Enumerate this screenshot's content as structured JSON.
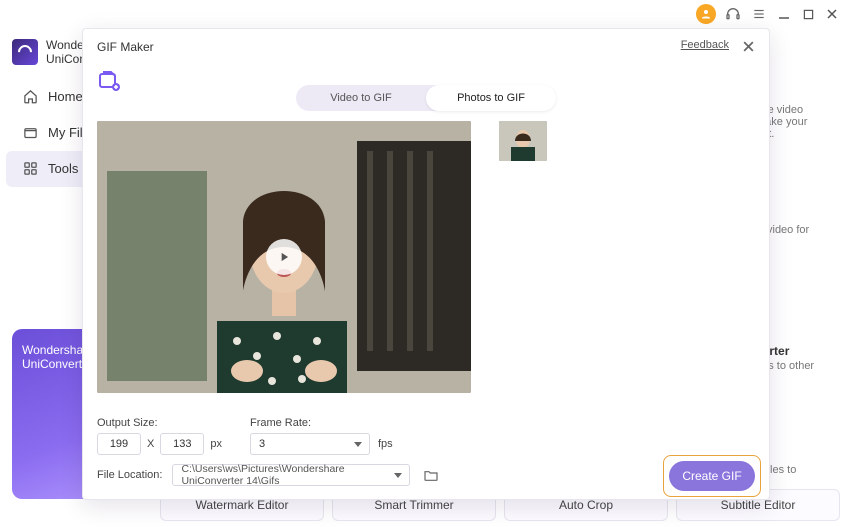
{
  "app": {
    "brand_line1": "Wondershare",
    "brand_line2": "UniConverter"
  },
  "sidebar": {
    "items": [
      {
        "label": "Home"
      },
      {
        "label": "My Files"
      },
      {
        "label": "Tools"
      }
    ]
  },
  "promo": {
    "line1": "Wondershare",
    "line2": "UniConverter"
  },
  "bg_cards": {
    "c1_text": "use video make your out.",
    "c2_text": "D video for",
    "c3_title": "verter",
    "c3_text": "ges to other",
    "c4_text": "y files to"
  },
  "footer_tools": [
    "Watermark Editor",
    "Smart Trimmer",
    "Auto Crop",
    "Subtitle Editor"
  ],
  "modal": {
    "title": "GIF Maker",
    "feedback": "Feedback",
    "tabs": {
      "video": "Video to GIF",
      "photos": "Photos to GIF"
    },
    "output_size_label": "Output Size:",
    "width": "199",
    "height": "133",
    "size_sep": "X",
    "size_unit": "px",
    "frame_rate_label": "Frame Rate:",
    "frame_rate_value": "3",
    "frame_rate_unit": "fps",
    "file_location_label": "File Location:",
    "file_location_value": "C:\\Users\\ws\\Pictures\\Wondershare UniConverter 14\\Gifs",
    "create_btn": "Create GIF"
  }
}
